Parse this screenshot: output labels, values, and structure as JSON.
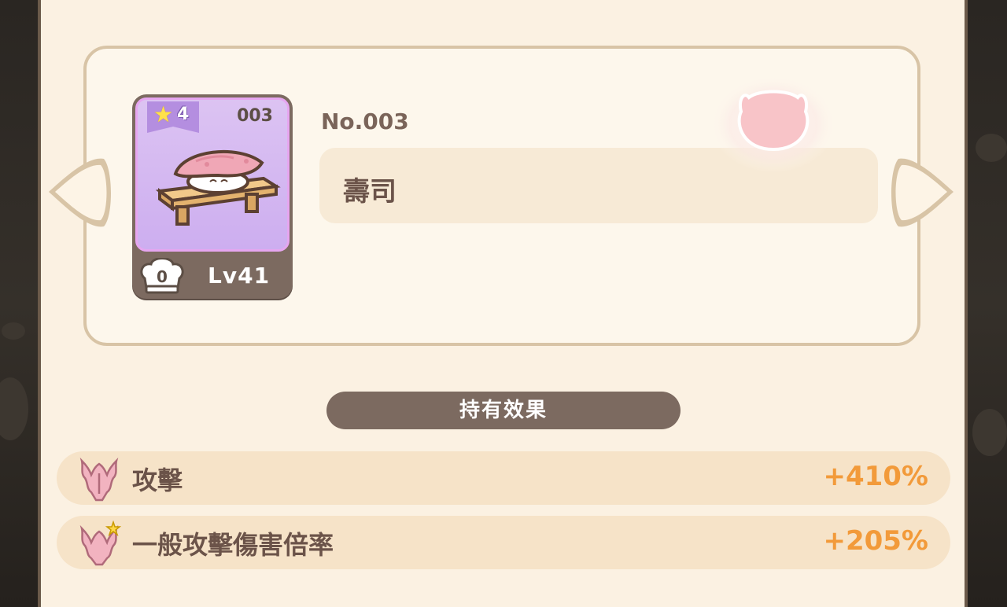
{
  "dish_card": {
    "stars": "4",
    "number": "003",
    "chef_count": "0",
    "level": "Lv41"
  },
  "dish": {
    "no_label": "No.003",
    "name": "壽司"
  },
  "effects": {
    "header": "持有效果",
    "rows": [
      {
        "label": "攻擊",
        "value": "+410%"
      },
      {
        "label": "一般攻擊傷害倍率",
        "value": "+205%"
      }
    ]
  },
  "colors": {
    "panel_bg": "#fbf1e2",
    "card_purple": "#cdaef0",
    "value_orange": "#f29a3a",
    "header_brown": "#7c6a60"
  },
  "icons": {
    "star": "star-icon",
    "chef_hat": "chef-hat-icon",
    "arrow_left": "arrow-left-icon",
    "arrow_right": "arrow-right-icon",
    "ghost": "ghost-icon",
    "attack": "attack-claw-icon",
    "attack_normal": "attack-claw-spark-icon"
  }
}
